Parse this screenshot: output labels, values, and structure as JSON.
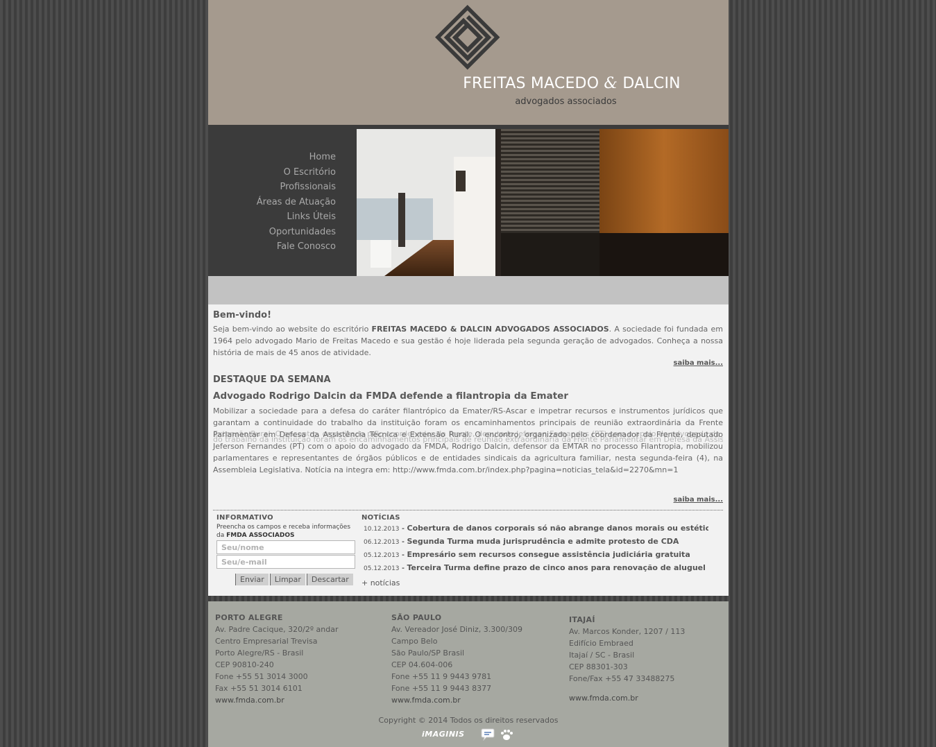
{
  "brand": {
    "name_part1": "FREITAS MACEDO",
    "ampersand": "&",
    "name_part2": "DALCIN",
    "tagline": "advogados associados"
  },
  "nav": {
    "items": [
      {
        "label": "Home"
      },
      {
        "label": "O Escritório"
      },
      {
        "label": "Profissionais"
      },
      {
        "label": "Áreas de Atuação"
      },
      {
        "label": "Links Úteis"
      },
      {
        "label": "Oportunidades"
      },
      {
        "label": "Fale Conosco"
      }
    ]
  },
  "welcome": {
    "title": "Bem-vindo!",
    "text_before": "Seja bem-vindo ao website do escritório ",
    "firm_bold": "FREITAS MACEDO & DALCIN ADVOGADOS ASSOCIADOS",
    "text_after": ". A sociedade foi fundada em 1964 pelo advogado Mario de Freitas Macedo e sua gestão é hoje liderada pela segunda geração de advogados. Conheça a nossa história de mais de 45 anos de atividade.",
    "more": "saiba mais..."
  },
  "destaque": {
    "heading": "DESTAQUE DA SEMANA",
    "title": "Advogado Rodrigo Dalcin da FMDA defende a filantropia da Emater",
    "body": "Mobilizar a sociedade para a defesa do caráter filantrópico da Emater/RS-Ascar e impetrar recursos e instrumentos jurídicos que garantam a continuidade do trabalho da instituição foram os encaminhamentos principais de reunião extraordinária da Frente Parlamentar em Defesa da Assistência Técnica e Extensão Rural. O encontro, organizado pelo coordenador da Frente, deputado Jeferson Fernandes (PT) com o apoio do advogado da FMDA, Rodrigo Dalcin, defensor da EMTAR no processo Filantropia, mobilizou parlamentares e representantes de órgãos públicos e de entidades sindicais da agricultura familiar, nesta segunda-feira (4), na Assembleia Legislativa. Notícia na integra em: http://www.fmda.com.br/index.php?pagina=noticias_tela&id=2270&mn=1",
    "ghost1": "Extensão Rural. O encontro, organizado pelo coordenador da Frente, deputado Jeferson Fernandes (PT) com o apoio do advogado da FMDA, Rodrigo",
    "ghost2": "do trabalho da instituição foram os encaminhamentos principais de reunião extraordinária da Frente Parlamentar em Defesa da Assistência Técnica e",
    "more": "saiba mais..."
  },
  "informativo": {
    "title": "INFORMATIVO",
    "text": "Preencha os campos e receba informações da ",
    "text_bold": "FMDA ASSOCIADOS",
    "name_placeholder": "Seu/nome",
    "email_placeholder": "Seu/e-mail",
    "btn_send": "Enviar",
    "btn_clear": "Limpar",
    "btn_unsubscribe": "Descartar"
  },
  "noticias": {
    "title": "NOTÍCIAS",
    "items": [
      {
        "date": "10.12.2013",
        "sep": " - ",
        "title": "Cobertura de danos corporais só não abrange danos morais ou estéticos ..."
      },
      {
        "date": "06.12.2013",
        "sep": " - ",
        "title": "Segunda Turma muda jurisprudência e admite protesto de CDA"
      },
      {
        "date": "05.12.2013",
        "sep": " - ",
        "title": "Empresário sem recursos consegue assistência judiciária gratuita"
      },
      {
        "date": "05.12.2013",
        "sep": " - ",
        "title": "Terceira Turma define prazo de cinco anos para renovação de aluguel co ..."
      }
    ],
    "more": "+ notícias"
  },
  "offices": [
    {
      "city": "PORTO ALEGRE",
      "lines": [
        "Av. Padre Cacique, 320/2º andar",
        "Centro Empresarial Trevisa",
        "Porto Alegre/RS - Brasil",
        "CEP 90810-240",
        "Fone +55 51 3014 3000",
        "Fax +55 51 3014 6101"
      ],
      "site": "www.fmda.com.br"
    },
    {
      "city": "SÃO PAULO",
      "lines": [
        "Av. Vereador José Diniz, 3.300/309",
        "Campo Belo",
        "São Paulo/SP Brasil",
        "CEP 04.604-006",
        "Fone +55 11 9 9443 9781",
        "Fone +55 11 9 9443 8377"
      ],
      "site": "www.fmda.com.br"
    },
    {
      "city": "ITAJAÍ",
      "lines": [
        "Av. Marcos Konder, 1207 / 113",
        "Edifício Embraed",
        "Itajaí / SC - Brasil",
        "CEP 88301-303",
        "Fone/Fax +55 47 33488275"
      ],
      "site": "www.fmda.com.br"
    }
  ],
  "footer": {
    "copyright": "Copyright © 2014 Todos os direitos reservados",
    "credit_logo": "iMAGINIS"
  },
  "colors": {
    "header_bg": "#a59a8e",
    "nav_bg": "#3b3b3b",
    "content_bg": "#f2f2f2",
    "footer_bg": "#a6a8a1"
  }
}
